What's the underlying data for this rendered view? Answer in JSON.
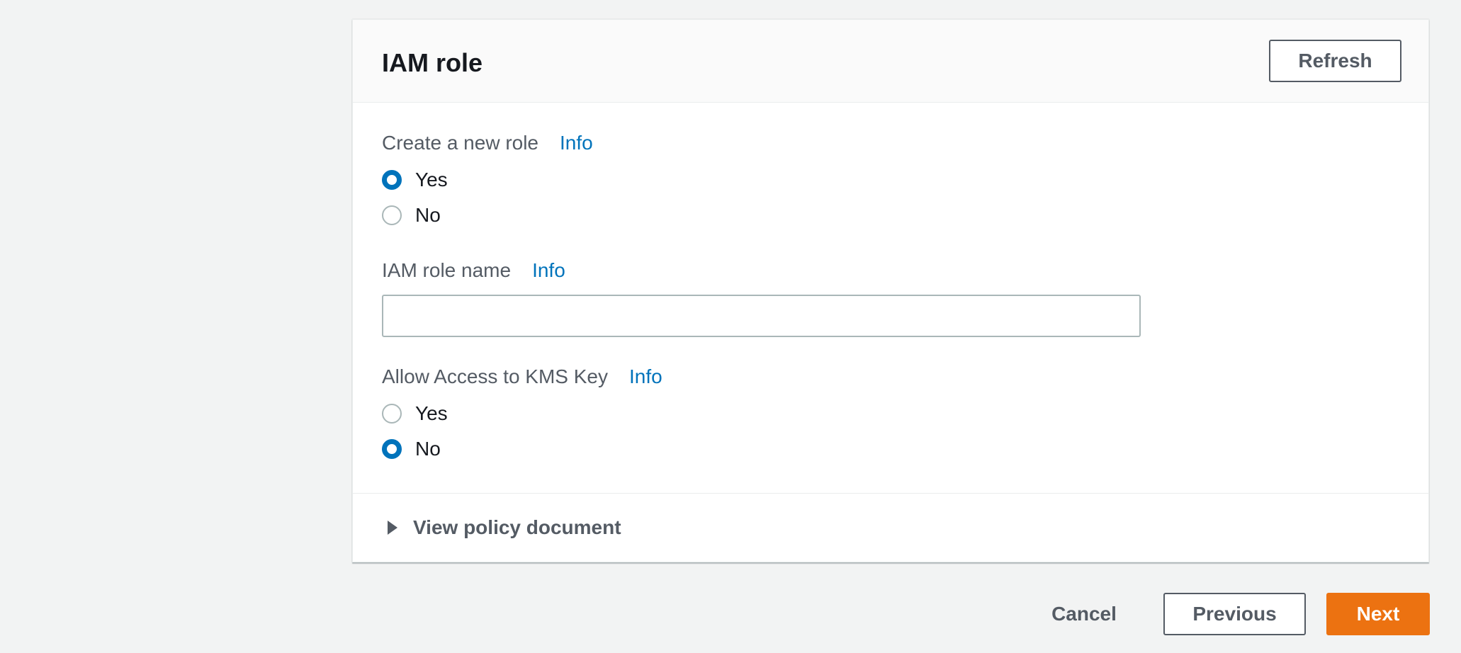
{
  "panel": {
    "title": "IAM role",
    "refresh_label": "Refresh"
  },
  "create_role": {
    "label": "Create a new role",
    "info": "Info",
    "options": [
      {
        "label": "Yes",
        "checked": true
      },
      {
        "label": "No",
        "checked": false
      }
    ]
  },
  "role_name": {
    "label": "IAM role name",
    "info": "Info",
    "value": "",
    "placeholder": ""
  },
  "kms_access": {
    "label": "Allow Access to KMS Key",
    "info": "Info",
    "options": [
      {
        "label": "Yes",
        "checked": false
      },
      {
        "label": "No",
        "checked": true
      }
    ]
  },
  "policy_expander": {
    "label": "View policy document",
    "icon": "caret-right-icon"
  },
  "footer": {
    "cancel_label": "Cancel",
    "previous_label": "Previous",
    "next_label": "Next"
  },
  "colors": {
    "primary": "#ec7211",
    "link": "#0073bb",
    "background": "#f2f3f3"
  }
}
